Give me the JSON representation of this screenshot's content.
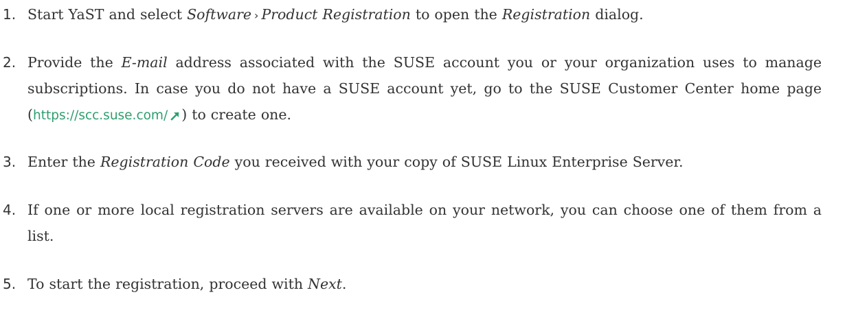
{
  "steps": [
    {
      "number": "1.",
      "text_1": "Start YaST and select ",
      "menu_1": "Software",
      "menu_sep": "›",
      "menu_2": "Product Registration",
      "text_2": " to open the ",
      "dialog_name": "Registration",
      "text_3": " dialog."
    },
    {
      "number": "2.",
      "text_1": "Provide the ",
      "field_name": "E-mail",
      "text_2": " address associated with the SUSE account you or your organization uses to manage subscriptions. In case you do not have a SUSE account yet, go to the SUSE Customer Center home page (",
      "link_text": "https://scc.suse.com/",
      "text_3": ") to create one."
    },
    {
      "number": "3.",
      "text_1": "Enter the ",
      "field_name": "Registration Code",
      "text_2": " you received with your copy of SUSE Linux Enterprise Server."
    },
    {
      "number": "4.",
      "text_1": "If one or more local registration servers are available on your network, you can choose one of them from a list."
    },
    {
      "number": "5.",
      "text_1": "To start the registration, proceed with ",
      "button_name": "Next",
      "text_2": "."
    }
  ],
  "colors": {
    "text": "#333333",
    "link": "#2e9e6e"
  },
  "icons": {
    "external_link": "external-link-arrow-icon"
  }
}
